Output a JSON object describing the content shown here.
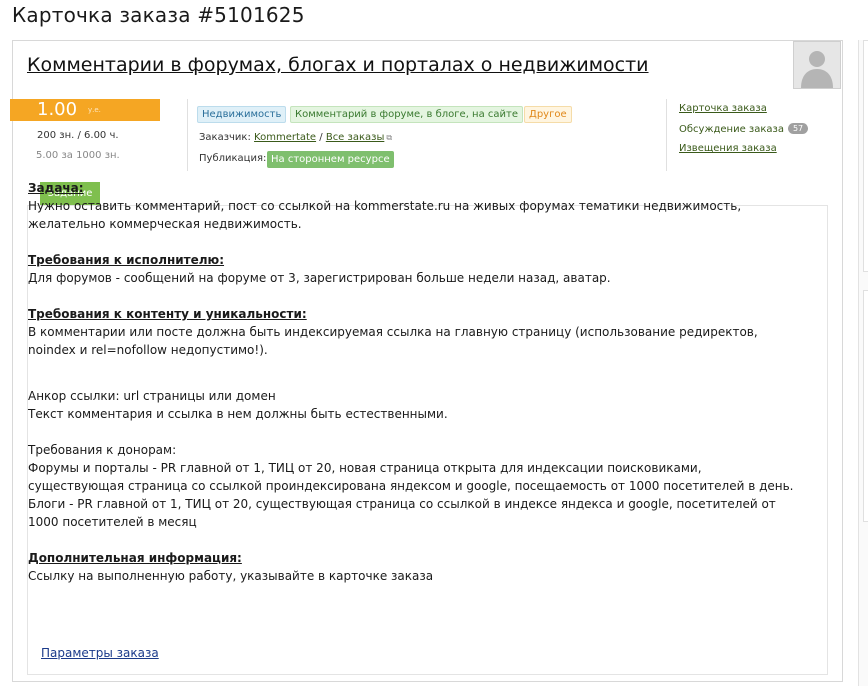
{
  "page": {
    "title": "Карточка заказа #5101625"
  },
  "order": {
    "title": "Комментарии в форумах, блогах и порталах о недвижимости",
    "price": "1.00",
    "price_unit": "у.е.",
    "rate": "200 зн. / 6.00 ч.",
    "rate_per_1000": "5.00 за 1000 зн."
  },
  "tags": [
    {
      "label": "Недвижимость"
    },
    {
      "label": "Комментарий в форуме, в блоге, на сайте"
    },
    {
      "label": "Другое"
    }
  ],
  "customer": {
    "label": "Заказчик:",
    "name": "Kommertate",
    "separator": "/",
    "all_orders": "Все заказы"
  },
  "publication": {
    "label": "Публикация:",
    "value": "На стороннем ресурсе"
  },
  "sidebar": {
    "links": [
      {
        "label": "Карточка заказа"
      },
      {
        "label": "Обсуждение заказа",
        "badge": "57"
      },
      {
        "label": "Извещения заказа"
      }
    ]
  },
  "tab": {
    "label": "Задание"
  },
  "content": {
    "task_heading": "Задача:",
    "task_text": "Нужно оставить комментарий, пост со ссылкой на kommerstate.ru на живых форумах тематики недвижимость, желательно коммерческая недвижимость.",
    "req_heading": "Требования к исполнителю:",
    "req_text": "Для форумов - сообщений на форуме от 3, зарегистрирован больше недели назад, аватар.",
    "content_heading": "Требования к контенту и уникальности:",
    "content_text": "В комментарии или посте должна быть индексируемая ссылка на главную страницу (использование редиректов, noindex и rel=nofollow недопустимо!).",
    "anchor_text": "Анкор ссылки: url страницы или домен",
    "natural_text": "Текст комментария и ссылка в нем должны быть естественными.",
    "donors_title": "Требования к донорам:",
    "donors_forums": "Форумы и порталы - PR главной от 1, ТИЦ от 20, новая страница открыта для индексации поисковиками, существующая страница со ссылкой проиндексирована яндексом и google, посещаемость от 1000 посетителей в день.",
    "donors_blogs": "Блоги - PR главной от 1, ТИЦ от 20, существующая страница со ссылкой в индексе яндекса и google, посетителей от 1000 посетителей в месяц",
    "extra_heading": "Дополнительная информация:",
    "extra_text": "Ссылку на выполненную работу, указывайте в карточке заказа",
    "params_link": "Параметры заказа"
  }
}
